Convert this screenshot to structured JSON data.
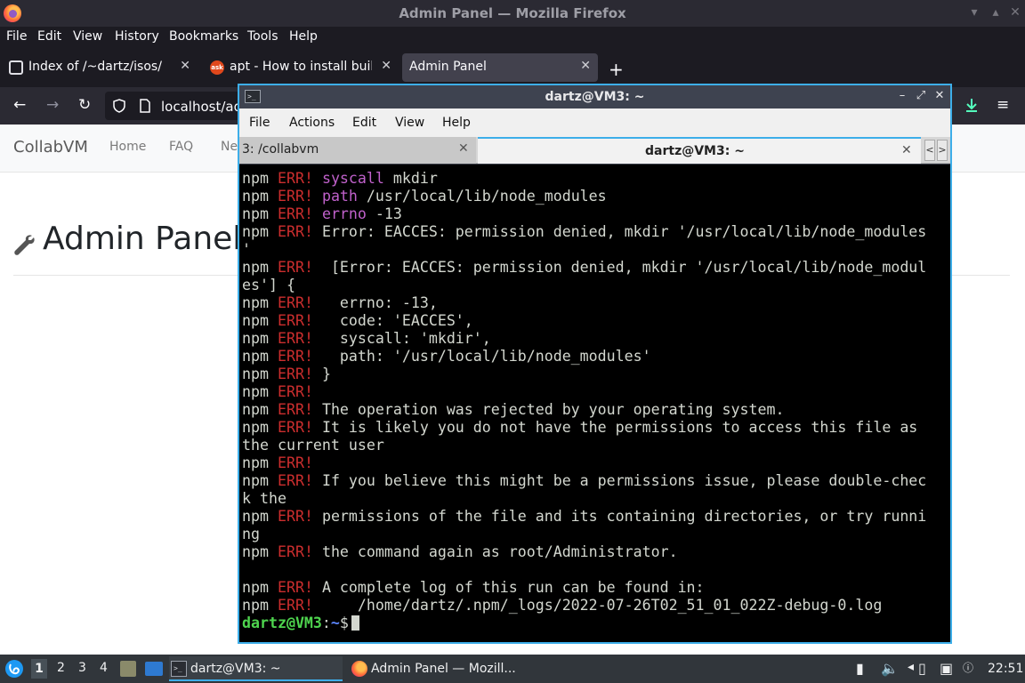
{
  "firefox": {
    "title": "Admin Panel — Mozilla Firefox",
    "menu": [
      "File",
      "Edit",
      "View",
      "History",
      "Bookmarks",
      "Tools",
      "Help"
    ],
    "tabs": [
      {
        "label": "Index of /~dartz/isos/"
      },
      {
        "label": "apt - How to install build-"
      },
      {
        "label": "Admin Panel"
      }
    ],
    "url": "localhost/ad"
  },
  "page": {
    "brand": "CollabVM",
    "nav": [
      "Home",
      "FAQ",
      "Ne"
    ],
    "heading": "Admin Panel"
  },
  "terminal": {
    "title": "dartz@VM3: ~",
    "menu": [
      "File",
      "Actions",
      "Edit",
      "View",
      "Help"
    ],
    "tabs": [
      {
        "label": "3: /collabvm"
      },
      {
        "label": "dartz@VM3: ~"
      }
    ],
    "lines": [
      {
        "p": "npm",
        "e": "ERR!",
        "k": "syscall",
        "r": " mkdir"
      },
      {
        "p": "npm",
        "e": "ERR!",
        "k": "path",
        "r": " /usr/local/lib/node_modules"
      },
      {
        "p": "npm",
        "e": "ERR!",
        "k": "errno",
        "r": " -13"
      },
      {
        "p": "npm",
        "e": "ERR!",
        "r": "Error: EACCES: permission denied, mkdir '/usr/local/lib/node_modules"
      },
      {
        "t": "'"
      },
      {
        "p": "npm",
        "e": "ERR!",
        "r": " [Error: EACCES: permission denied, mkdir '/usr/local/lib/node_modul"
      },
      {
        "t": "es'] {"
      },
      {
        "p": "npm",
        "e": "ERR!",
        "r": "  errno: -13,"
      },
      {
        "p": "npm",
        "e": "ERR!",
        "r": "  code: 'EACCES',"
      },
      {
        "p": "npm",
        "e": "ERR!",
        "r": "  syscall: 'mkdir',"
      },
      {
        "p": "npm",
        "e": "ERR!",
        "r": "  path: '/usr/local/lib/node_modules'"
      },
      {
        "p": "npm",
        "e": "ERR!",
        "r": "}"
      },
      {
        "p": "npm",
        "e": "ERR!",
        "r": ""
      },
      {
        "p": "npm",
        "e": "ERR!",
        "r": "The operation was rejected by your operating system."
      },
      {
        "p": "npm",
        "e": "ERR!",
        "r": "It is likely you do not have the permissions to access this file as"
      },
      {
        "t": "the current user"
      },
      {
        "p": "npm",
        "e": "ERR!",
        "r": ""
      },
      {
        "p": "npm",
        "e": "ERR!",
        "r": "If you believe this might be a permissions issue, please double-chec"
      },
      {
        "t": "k the"
      },
      {
        "p": "npm",
        "e": "ERR!",
        "r": "permissions of the file and its containing directories, or try runni"
      },
      {
        "t": "ng"
      },
      {
        "p": "npm",
        "e": "ERR!",
        "r": "the command again as root/Administrator."
      },
      {
        "t": ""
      },
      {
        "p": "npm",
        "e": "ERR!",
        "r": "A complete log of this run can be found in:"
      },
      {
        "p": "npm",
        "e": "ERR!",
        "r": "    /home/dartz/.npm/_logs/2022-07-26T02_51_01_022Z-debug-0.log"
      }
    ],
    "prompt_user": "dartz@VM3",
    "prompt_sep": ":",
    "prompt_path": "~",
    "prompt_sym": "$"
  },
  "taskbar": {
    "workspaces": [
      "1",
      "2",
      "3",
      "4"
    ],
    "tasks": [
      {
        "label": "dartz@VM3: ~"
      },
      {
        "label": "Admin Panel — Mozill..."
      }
    ],
    "clock": "22:51"
  },
  "colors": {
    "accent": "#3daee9",
    "err": "#cc2e2e",
    "keyword": "#c061cb",
    "prompt": "#4ed44e"
  }
}
